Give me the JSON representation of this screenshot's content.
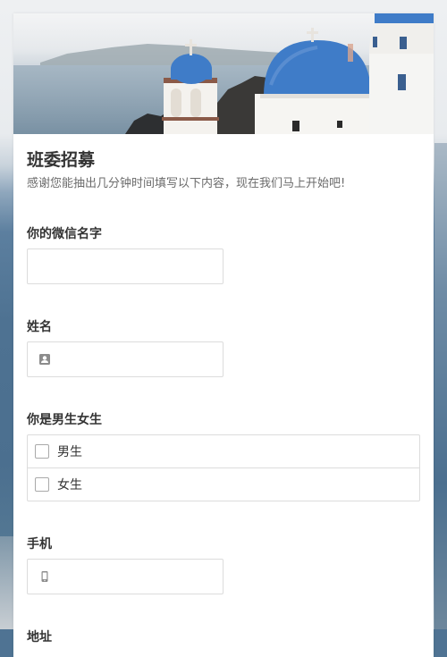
{
  "form": {
    "title": "班委招募",
    "description": "感谢您能抽出几分钟时间填写以下内容，现在我们马上开始吧!"
  },
  "fields": {
    "wechat_name": {
      "label": "你的微信名字",
      "value": ""
    },
    "name": {
      "label": "姓名",
      "value": "",
      "icon": "contact-card-icon"
    },
    "gender": {
      "label": "你是男生女生",
      "options": [
        {
          "label": "男生",
          "checked": false
        },
        {
          "label": "女生",
          "checked": false
        }
      ]
    },
    "phone": {
      "label": "手机",
      "value": "",
      "icon": "mobile-phone-icon"
    },
    "address": {
      "label": "地址"
    }
  },
  "colors": {
    "dome_blue": "#3f7cc8",
    "card_background": "#ffffff",
    "input_border": "#dcdcdc"
  }
}
